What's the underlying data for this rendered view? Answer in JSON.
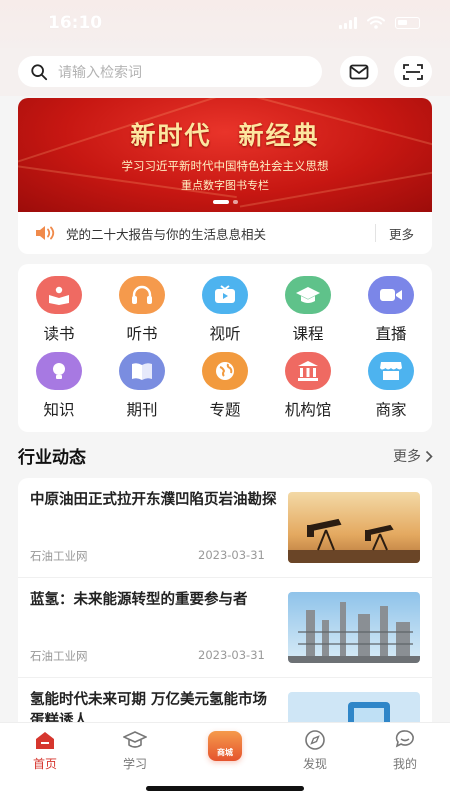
{
  "status": {
    "time": "16:10"
  },
  "search": {
    "placeholder": "请输入检索词"
  },
  "header_icons": {
    "mail": "mail-icon",
    "scan": "scan-icon"
  },
  "banner": {
    "title": "新时代　新经典",
    "subtitle1": "学习习近平新时代中国特色社会主义思想",
    "subtitle2": "重点数字图书专栏",
    "accent": "#c71712"
  },
  "notice": {
    "text": "党的二十大报告与你的生活息息相关",
    "more": "更多"
  },
  "categories": [
    {
      "label": "读书",
      "icon": "book-reader-icon",
      "color": "#ef6a62"
    },
    {
      "label": "听书",
      "icon": "headphones-icon",
      "color": "#f59a4c"
    },
    {
      "label": "视听",
      "icon": "tv-icon",
      "color": "#4db3ef"
    },
    {
      "label": "课程",
      "icon": "graduation-cap-icon",
      "color": "#5fc28a"
    },
    {
      "label": "直播",
      "icon": "video-camera-icon",
      "color": "#7b86e8"
    },
    {
      "label": "知识",
      "icon": "lightbulb-icon",
      "color": "#a779e2"
    },
    {
      "label": "期刊",
      "icon": "magazine-icon",
      "color": "#7a8de0"
    },
    {
      "label": "专题",
      "icon": "globe-icon",
      "color": "#f29a3e"
    },
    {
      "label": "机构馆",
      "icon": "institution-icon",
      "color": "#ef6a62"
    },
    {
      "label": "商家",
      "icon": "store-icon",
      "color": "#4db3ef"
    }
  ],
  "section": {
    "title": "行业动态",
    "more": "更多"
  },
  "news": [
    {
      "title": "中原油田正式拉开东濮凹陷页岩油勘探",
      "source": "石油工业网",
      "date": "2023-03-31",
      "thumb": "oil-pump-sunset"
    },
    {
      "title": "蓝氢：未来能源转型的重要参与者",
      "source": "石油工业网",
      "date": "2023-03-31",
      "thumb": "refinery-towers"
    },
    {
      "title": "氢能时代未来可期 万亿美元氢能市场蛋糕诱人",
      "source": "",
      "date": "",
      "thumb": "hydrogen-station"
    }
  ],
  "tabs": [
    {
      "label": "首页",
      "icon": "home-icon",
      "active": true
    },
    {
      "label": "学习",
      "icon": "graduation-cap-icon",
      "active": false
    },
    {
      "label": "商城",
      "icon": "shopping-bag-icon",
      "active": false
    },
    {
      "label": "发现",
      "icon": "compass-icon",
      "active": false
    },
    {
      "label": "我的",
      "icon": "chat-bubble-icon",
      "active": false
    }
  ],
  "colors": {
    "brand_red": "#d6362e"
  }
}
